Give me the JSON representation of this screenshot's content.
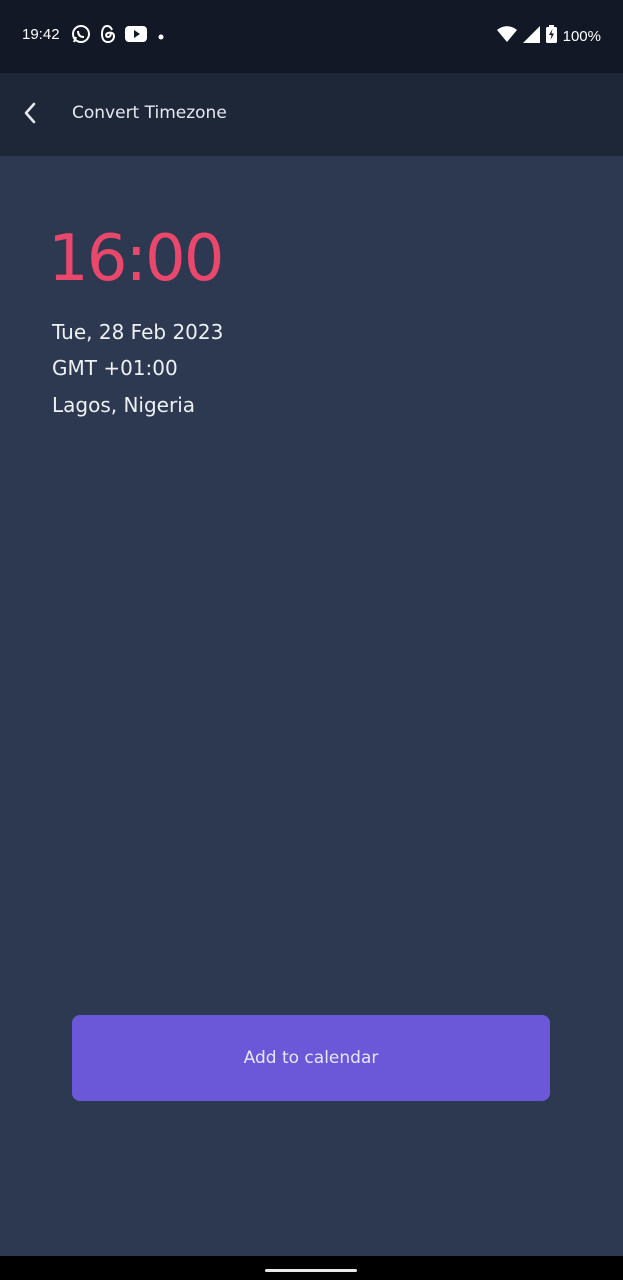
{
  "status_bar": {
    "time": "19:42",
    "battery": "100%",
    "icons_left": [
      "whatsapp-icon",
      "threads-icon",
      "youtube-icon",
      "dot-icon"
    ],
    "icons_right": [
      "wifi-icon",
      "signal-icon",
      "battery-charging-icon"
    ]
  },
  "app_bar": {
    "title": "Convert Timezone"
  },
  "result": {
    "time": "16:00",
    "date": "Tue, 28 Feb 2023",
    "offset": "GMT +01:00",
    "location": "Lagos, Nigeria"
  },
  "actions": {
    "add_to_calendar": "Add to calendar"
  },
  "colors": {
    "background": "#2c3951",
    "app_bar": "#1e2738",
    "accent_time": "#e9476c",
    "button": "#6a58d9"
  }
}
